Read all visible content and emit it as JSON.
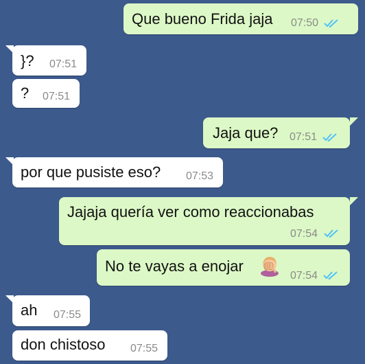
{
  "messages": [
    {
      "id": "m1",
      "dir": "out",
      "text": "Que bueno Frida jaja",
      "time": "07:50"
    },
    {
      "id": "m2",
      "dir": "in",
      "text": "}?",
      "time": "07:51"
    },
    {
      "id": "m3",
      "dir": "in",
      "text": "?",
      "time": "07:51"
    },
    {
      "id": "m4",
      "dir": "out",
      "text": "Jaja que?",
      "time": "07:51"
    },
    {
      "id": "m5",
      "dir": "in",
      "text": "por que pusiste eso?",
      "time": "07:53"
    },
    {
      "id": "m6",
      "dir": "out",
      "text": "Jajaja quería ver como reaccionabas",
      "time": "07:54"
    },
    {
      "id": "m7",
      "dir": "out",
      "text": "No te vayas a enojar",
      "time": "07:54",
      "emoji": "face-palm-emoji"
    },
    {
      "id": "m8",
      "dir": "in",
      "text": "ah",
      "time": "07:55"
    },
    {
      "id": "m9",
      "dir": "in",
      "text": "don chistoso",
      "time": "07:55"
    }
  ],
  "icons": {
    "read_receipt": "double-check-icon",
    "read_color": "#4fc3f7"
  },
  "colors": {
    "background": "#3c5a8c",
    "outgoing": "#dcf8c6",
    "incoming": "#ffffff"
  }
}
